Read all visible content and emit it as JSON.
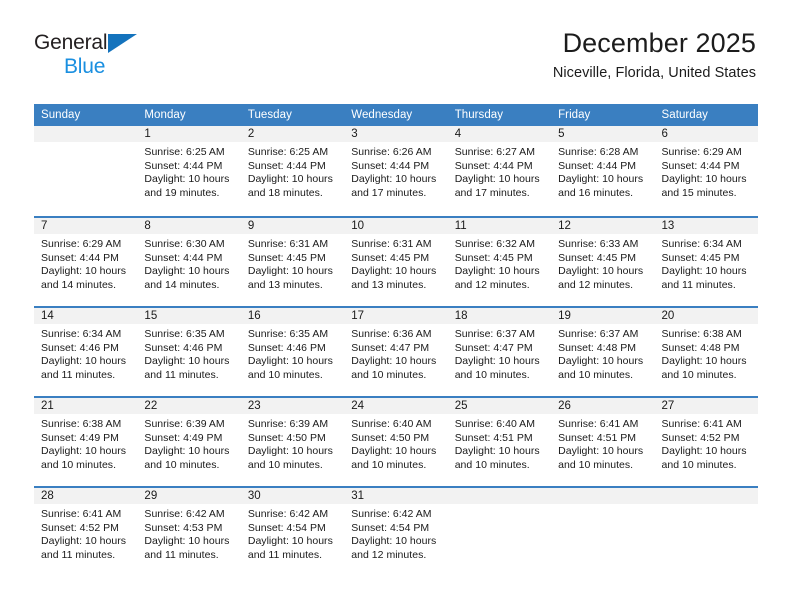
{
  "brand": {
    "name_top": "General",
    "name_bottom": "Blue",
    "triangle_color": "#1473bd",
    "blue_text_color": "#1a8fe0"
  },
  "header": {
    "title": "December 2025",
    "subtitle": "Niceville, Florida, United States"
  },
  "theme": {
    "header_blue": "#3a7fc1",
    "daynum_band": "#f2f2f2",
    "text": "#1a1a1a"
  },
  "weekday_headers": [
    "Sunday",
    "Monday",
    "Tuesday",
    "Wednesday",
    "Thursday",
    "Friday",
    "Saturday"
  ],
  "weeks": [
    [
      {
        "day": "",
        "sunrise": "",
        "sunset": "",
        "daylight_line1": "",
        "daylight_line2": "",
        "empty": true
      },
      {
        "day": "1",
        "sunrise": "Sunrise: 6:25 AM",
        "sunset": "Sunset: 4:44 PM",
        "daylight_line1": "Daylight: 10 hours",
        "daylight_line2": "and 19 minutes."
      },
      {
        "day": "2",
        "sunrise": "Sunrise: 6:25 AM",
        "sunset": "Sunset: 4:44 PM",
        "daylight_line1": "Daylight: 10 hours",
        "daylight_line2": "and 18 minutes."
      },
      {
        "day": "3",
        "sunrise": "Sunrise: 6:26 AM",
        "sunset": "Sunset: 4:44 PM",
        "daylight_line1": "Daylight: 10 hours",
        "daylight_line2": "and 17 minutes."
      },
      {
        "day": "4",
        "sunrise": "Sunrise: 6:27 AM",
        "sunset": "Sunset: 4:44 PM",
        "daylight_line1": "Daylight: 10 hours",
        "daylight_line2": "and 17 minutes."
      },
      {
        "day": "5",
        "sunrise": "Sunrise: 6:28 AM",
        "sunset": "Sunset: 4:44 PM",
        "daylight_line1": "Daylight: 10 hours",
        "daylight_line2": "and 16 minutes."
      },
      {
        "day": "6",
        "sunrise": "Sunrise: 6:29 AM",
        "sunset": "Sunset: 4:44 PM",
        "daylight_line1": "Daylight: 10 hours",
        "daylight_line2": "and 15 minutes."
      }
    ],
    [
      {
        "day": "7",
        "sunrise": "Sunrise: 6:29 AM",
        "sunset": "Sunset: 4:44 PM",
        "daylight_line1": "Daylight: 10 hours",
        "daylight_line2": "and 14 minutes."
      },
      {
        "day": "8",
        "sunrise": "Sunrise: 6:30 AM",
        "sunset": "Sunset: 4:44 PM",
        "daylight_line1": "Daylight: 10 hours",
        "daylight_line2": "and 14 minutes."
      },
      {
        "day": "9",
        "sunrise": "Sunrise: 6:31 AM",
        "sunset": "Sunset: 4:45 PM",
        "daylight_line1": "Daylight: 10 hours",
        "daylight_line2": "and 13 minutes."
      },
      {
        "day": "10",
        "sunrise": "Sunrise: 6:31 AM",
        "sunset": "Sunset: 4:45 PM",
        "daylight_line1": "Daylight: 10 hours",
        "daylight_line2": "and 13 minutes."
      },
      {
        "day": "11",
        "sunrise": "Sunrise: 6:32 AM",
        "sunset": "Sunset: 4:45 PM",
        "daylight_line1": "Daylight: 10 hours",
        "daylight_line2": "and 12 minutes."
      },
      {
        "day": "12",
        "sunrise": "Sunrise: 6:33 AM",
        "sunset": "Sunset: 4:45 PM",
        "daylight_line1": "Daylight: 10 hours",
        "daylight_line2": "and 12 minutes."
      },
      {
        "day": "13",
        "sunrise": "Sunrise: 6:34 AM",
        "sunset": "Sunset: 4:45 PM",
        "daylight_line1": "Daylight: 10 hours",
        "daylight_line2": "and 11 minutes."
      }
    ],
    [
      {
        "day": "14",
        "sunrise": "Sunrise: 6:34 AM",
        "sunset": "Sunset: 4:46 PM",
        "daylight_line1": "Daylight: 10 hours",
        "daylight_line2": "and 11 minutes."
      },
      {
        "day": "15",
        "sunrise": "Sunrise: 6:35 AM",
        "sunset": "Sunset: 4:46 PM",
        "daylight_line1": "Daylight: 10 hours",
        "daylight_line2": "and 11 minutes."
      },
      {
        "day": "16",
        "sunrise": "Sunrise: 6:35 AM",
        "sunset": "Sunset: 4:46 PM",
        "daylight_line1": "Daylight: 10 hours",
        "daylight_line2": "and 10 minutes."
      },
      {
        "day": "17",
        "sunrise": "Sunrise: 6:36 AM",
        "sunset": "Sunset: 4:47 PM",
        "daylight_line1": "Daylight: 10 hours",
        "daylight_line2": "and 10 minutes."
      },
      {
        "day": "18",
        "sunrise": "Sunrise: 6:37 AM",
        "sunset": "Sunset: 4:47 PM",
        "daylight_line1": "Daylight: 10 hours",
        "daylight_line2": "and 10 minutes."
      },
      {
        "day": "19",
        "sunrise": "Sunrise: 6:37 AM",
        "sunset": "Sunset: 4:48 PM",
        "daylight_line1": "Daylight: 10 hours",
        "daylight_line2": "and 10 minutes."
      },
      {
        "day": "20",
        "sunrise": "Sunrise: 6:38 AM",
        "sunset": "Sunset: 4:48 PM",
        "daylight_line1": "Daylight: 10 hours",
        "daylight_line2": "and 10 minutes."
      }
    ],
    [
      {
        "day": "21",
        "sunrise": "Sunrise: 6:38 AM",
        "sunset": "Sunset: 4:49 PM",
        "daylight_line1": "Daylight: 10 hours",
        "daylight_line2": "and 10 minutes."
      },
      {
        "day": "22",
        "sunrise": "Sunrise: 6:39 AM",
        "sunset": "Sunset: 4:49 PM",
        "daylight_line1": "Daylight: 10 hours",
        "daylight_line2": "and 10 minutes."
      },
      {
        "day": "23",
        "sunrise": "Sunrise: 6:39 AM",
        "sunset": "Sunset: 4:50 PM",
        "daylight_line1": "Daylight: 10 hours",
        "daylight_line2": "and 10 minutes."
      },
      {
        "day": "24",
        "sunrise": "Sunrise: 6:40 AM",
        "sunset": "Sunset: 4:50 PM",
        "daylight_line1": "Daylight: 10 hours",
        "daylight_line2": "and 10 minutes."
      },
      {
        "day": "25",
        "sunrise": "Sunrise: 6:40 AM",
        "sunset": "Sunset: 4:51 PM",
        "daylight_line1": "Daylight: 10 hours",
        "daylight_line2": "and 10 minutes."
      },
      {
        "day": "26",
        "sunrise": "Sunrise: 6:41 AM",
        "sunset": "Sunset: 4:51 PM",
        "daylight_line1": "Daylight: 10 hours",
        "daylight_line2": "and 10 minutes."
      },
      {
        "day": "27",
        "sunrise": "Sunrise: 6:41 AM",
        "sunset": "Sunset: 4:52 PM",
        "daylight_line1": "Daylight: 10 hours",
        "daylight_line2": "and 10 minutes."
      }
    ],
    [
      {
        "day": "28",
        "sunrise": "Sunrise: 6:41 AM",
        "sunset": "Sunset: 4:52 PM",
        "daylight_line1": "Daylight: 10 hours",
        "daylight_line2": "and 11 minutes."
      },
      {
        "day": "29",
        "sunrise": "Sunrise: 6:42 AM",
        "sunset": "Sunset: 4:53 PM",
        "daylight_line1": "Daylight: 10 hours",
        "daylight_line2": "and 11 minutes."
      },
      {
        "day": "30",
        "sunrise": "Sunrise: 6:42 AM",
        "sunset": "Sunset: 4:54 PM",
        "daylight_line1": "Daylight: 10 hours",
        "daylight_line2": "and 11 minutes."
      },
      {
        "day": "31",
        "sunrise": "Sunrise: 6:42 AM",
        "sunset": "Sunset: 4:54 PM",
        "daylight_line1": "Daylight: 10 hours",
        "daylight_line2": "and 12 minutes."
      },
      {
        "day": "",
        "sunrise": "",
        "sunset": "",
        "daylight_line1": "",
        "daylight_line2": "",
        "empty": true
      },
      {
        "day": "",
        "sunrise": "",
        "sunset": "",
        "daylight_line1": "",
        "daylight_line2": "",
        "empty": true
      },
      {
        "day": "",
        "sunrise": "",
        "sunset": "",
        "daylight_line1": "",
        "daylight_line2": "",
        "empty": true
      }
    ]
  ]
}
